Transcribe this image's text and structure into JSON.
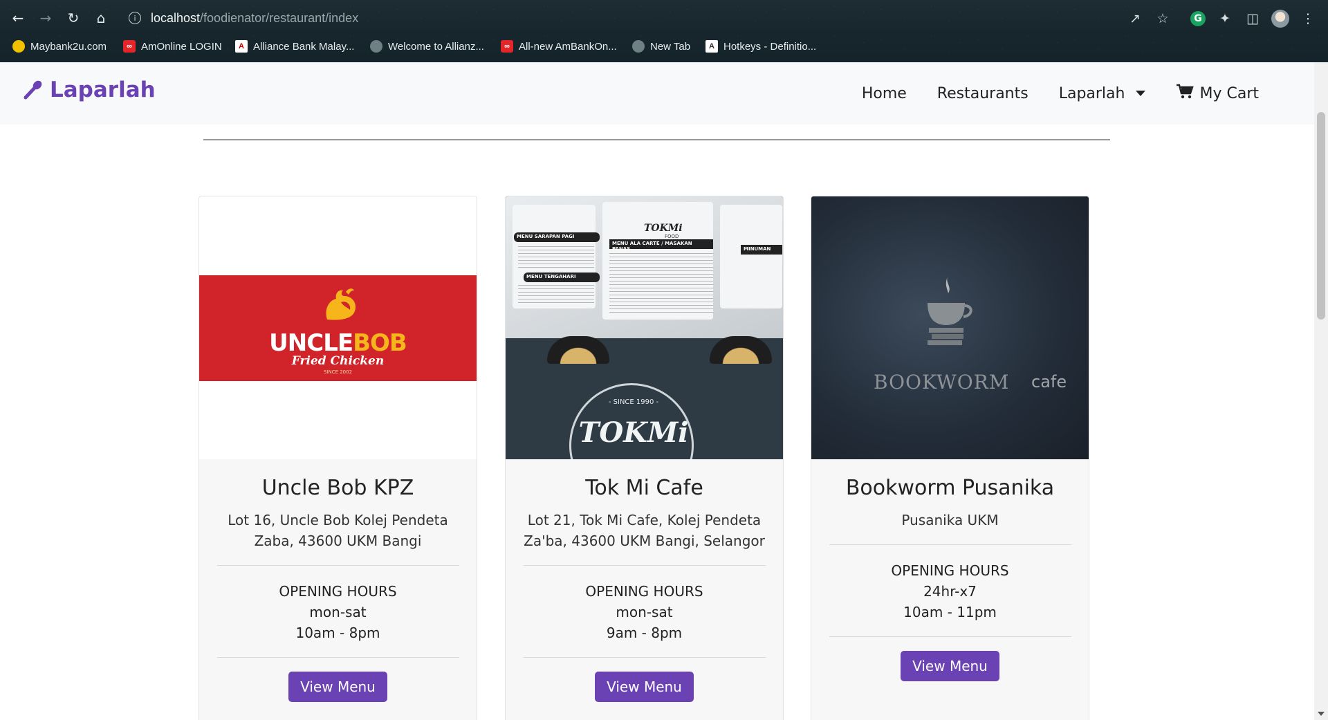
{
  "browser": {
    "url_host": "localhost",
    "url_path": "/foodienator/restaurant/index",
    "bookmarks": [
      {
        "label": "Maybank2u.com",
        "color": "#f2c200"
      },
      {
        "label": "AmOnline LOGIN",
        "color": "#e4262b"
      },
      {
        "label": "Alliance Bank Malay...",
        "color": "#ffffff"
      },
      {
        "label": "Welcome to Allianz...",
        "color": "#9aa"
      },
      {
        "label": "All-new AmBankOn...",
        "color": "#e4262b"
      },
      {
        "label": "New Tab",
        "color": "#9aa"
      },
      {
        "label": "Hotkeys - Definitio...",
        "color": "#ffffff"
      }
    ]
  },
  "navbar": {
    "brand": "Laparlah",
    "links": {
      "home": "Home",
      "restaurants": "Restaurants",
      "dropdown": "Laparlah",
      "cart": "My Cart"
    }
  },
  "cards": [
    {
      "title": "Uncle Bob KPZ",
      "address": "Lot 16, Uncle Bob Kolej Pendeta Zaba, 43600 UKM Bangi",
      "hours_label": "OPENING HOURS",
      "days": "mon-sat",
      "time": "10am - 8pm",
      "button": "View Menu",
      "logo_text_1": "UNCLE",
      "logo_text_2": "BOB",
      "logo_sub": "Fried Chicken",
      "logo_since": "SINCE 2002"
    },
    {
      "title": "Tok Mi Cafe",
      "address": "Lot 21, Tok Mi Cafe, Kolej Pendeta Za'ba, 43600 UKM Bangi, Selangor",
      "hours_label": "OPENING HOURS",
      "days": "mon-sat",
      "time": "9am - 8pm",
      "button": "View Menu",
      "sign_since": "- SINCE 1990 -",
      "sign_name": "TOKMi",
      "board_title": "TOKMi",
      "board_sub": "FOOD",
      "board_menu1": "MENU SARAPAN PAGI",
      "board_menu2": "MENU ALA CARTE / MASAKAN PANAS",
      "board_menu3": "MENU TENGAHARI",
      "board_menu4": "MINUMAN"
    },
    {
      "title": "Bookworm Pusanika",
      "address": "Pusanika UKM",
      "hours_label": "OPENING HOURS",
      "days": "24hr-x7",
      "time": "10am - 11pm",
      "button": "View Menu",
      "logo_word": "BOOKWORM",
      "logo_cafe": "cafe"
    }
  ]
}
